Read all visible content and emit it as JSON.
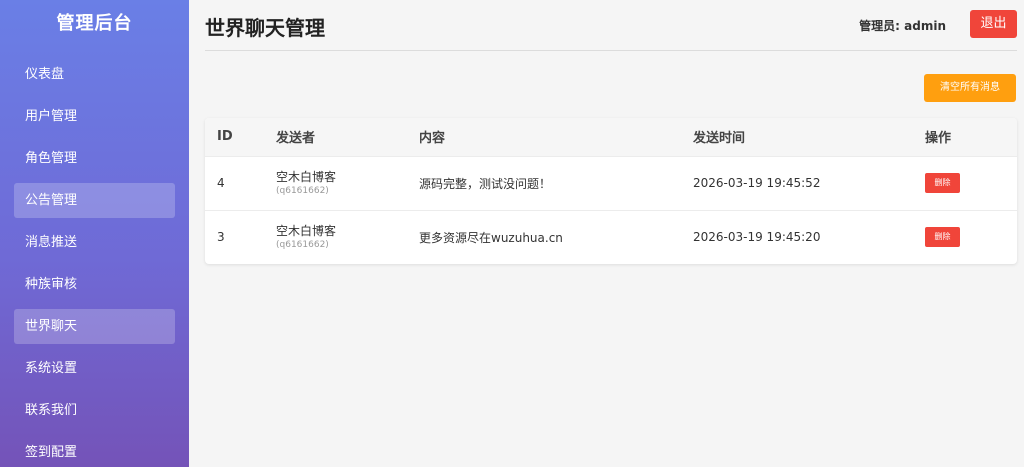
{
  "sidebar": {
    "title": "管理后台",
    "items": [
      {
        "label": "仪表盘",
        "active": false
      },
      {
        "label": "用户管理",
        "active": false
      },
      {
        "label": "角色管理",
        "active": false
      },
      {
        "label": "公告管理",
        "active": true
      },
      {
        "label": "消息推送",
        "active": false
      },
      {
        "label": "种族审核",
        "active": false
      },
      {
        "label": "世界聊天",
        "active": true
      },
      {
        "label": "系统设置",
        "active": false
      },
      {
        "label": "联系我们",
        "active": false
      },
      {
        "label": "签到配置",
        "active": false
      }
    ]
  },
  "header": {
    "title": "世界聊天管理",
    "admin_label": "管理员: admin",
    "logout_label": "退出"
  },
  "toolbar": {
    "clear_all_label": "清空所有消息"
  },
  "table": {
    "columns": [
      "ID",
      "发送者",
      "内容",
      "发送时间",
      "操作"
    ],
    "rows": [
      {
        "id": "4",
        "sender": "空木白博客",
        "sender_id": "(q6161662)",
        "content": "源码完整，测试没问题！",
        "time": "2026-03-19 19:45:52",
        "action": "删除"
      },
      {
        "id": "3",
        "sender": "空木白博客",
        "sender_id": "(q6161662)",
        "content": "更多资源尽在wuzuhua.cn",
        "time": "2026-03-19 19:45:20",
        "action": "删除"
      }
    ]
  },
  "colors": {
    "sidebar_gradient_top": "#6a7fe6",
    "sidebar_gradient_bottom": "#7453b8",
    "danger": "#f0453a",
    "warning": "#ff9f0f"
  }
}
